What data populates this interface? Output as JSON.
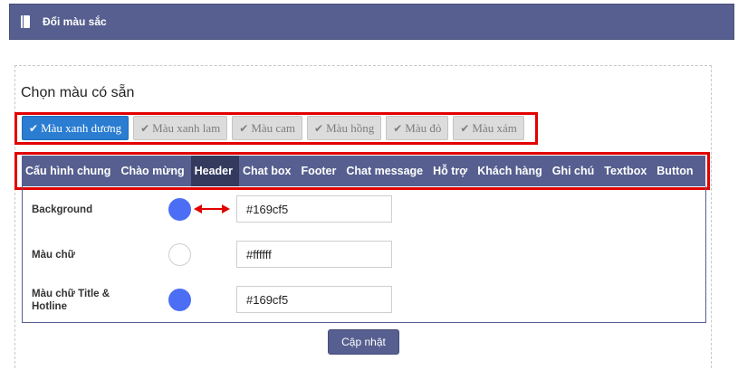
{
  "header": {
    "title": "Đổi màu sắc",
    "icon": "book-icon"
  },
  "presets": {
    "title": "Chọn màu có sẵn",
    "buttons": [
      {
        "label": "Màu xanh dương",
        "active": true
      },
      {
        "label": "Màu xanh lam",
        "active": false
      },
      {
        "label": "Màu cam",
        "active": false
      },
      {
        "label": "Màu hồng",
        "active": false
      },
      {
        "label": "Màu đỏ",
        "active": false
      },
      {
        "label": "Màu xám",
        "active": false
      }
    ]
  },
  "tabs": [
    {
      "label": "Cấu hình chung",
      "active": false
    },
    {
      "label": "Chào mừng",
      "active": false
    },
    {
      "label": "Header",
      "active": true
    },
    {
      "label": "Chat box",
      "active": false
    },
    {
      "label": "Footer",
      "active": false
    },
    {
      "label": "Chat message",
      "active": false
    },
    {
      "label": "Hỗ trợ",
      "active": false
    },
    {
      "label": "Khách hàng",
      "active": false
    },
    {
      "label": "Ghi chú",
      "active": false
    },
    {
      "label": "Textbox",
      "active": false
    },
    {
      "label": "Button",
      "active": false
    }
  ],
  "settings": {
    "background": {
      "label": "Background",
      "value": "#169cf5",
      "swatch_color": "#4b6ef5"
    },
    "text_color": {
      "label": "Màu chữ",
      "value": "#ffffff",
      "swatch_color": "#ffffff"
    },
    "title_hotline": {
      "label": "Màu chữ Title & Hotline",
      "value": "#169cf5",
      "swatch_color": "#4b6ef5"
    }
  },
  "actions": {
    "update_label": "Cập nhật"
  },
  "colors": {
    "header_bg": "#565f8f",
    "tab_active_bg": "#343a5e",
    "preset_active_bg": "#2a7dd1",
    "highlight_red": "#e20000"
  }
}
